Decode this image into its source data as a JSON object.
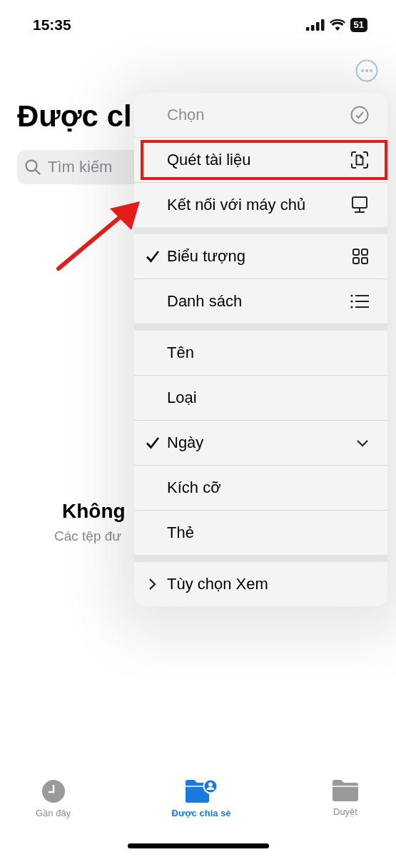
{
  "status_bar": {
    "time": "15:35",
    "battery": "51"
  },
  "title": "Được cl",
  "search": {
    "placeholder": "Tìm kiếm"
  },
  "empty_state": {
    "title": "Không",
    "subtitle": "Các tệp đư"
  },
  "menu": {
    "sections": [
      {
        "items": [
          {
            "label": "Chọn",
            "kind": "select",
            "disabled": true,
            "checked": false,
            "highlighted": false
          },
          {
            "label": "Quét tài liệu",
            "kind": "scan",
            "disabled": false,
            "checked": false,
            "highlighted": true
          },
          {
            "label": "Kết nối với máy chủ",
            "kind": "server",
            "disabled": false,
            "checked": false,
            "highlighted": false
          }
        ]
      },
      {
        "items": [
          {
            "label": "Biểu tượng",
            "kind": "grid",
            "disabled": false,
            "checked": true,
            "highlighted": false
          },
          {
            "label": "Danh sách",
            "kind": "list",
            "disabled": false,
            "checked": false,
            "highlighted": false
          }
        ]
      },
      {
        "items": [
          {
            "label": "Tên",
            "kind": "sort",
            "disabled": false,
            "checked": false,
            "highlighted": false
          },
          {
            "label": "Loại",
            "kind": "sort",
            "disabled": false,
            "checked": false,
            "highlighted": false
          },
          {
            "label": "Ngày",
            "kind": "sort",
            "disabled": false,
            "checked": true,
            "highlighted": false
          },
          {
            "label": "Kích cỡ",
            "kind": "sort",
            "disabled": false,
            "checked": false,
            "highlighted": false
          },
          {
            "label": "Thẻ",
            "kind": "sort",
            "disabled": false,
            "checked": false,
            "highlighted": false
          }
        ]
      },
      {
        "items": [
          {
            "label": "Tùy chọn Xem",
            "kind": "submenu",
            "disabled": false,
            "checked": false,
            "highlighted": false
          }
        ]
      }
    ]
  },
  "tabs": [
    {
      "label": "Gần đây",
      "kind": "recent",
      "selected": false
    },
    {
      "label": "Được chia sẻ",
      "kind": "shared",
      "selected": true
    },
    {
      "label": "Duyệt",
      "kind": "browse",
      "selected": false
    }
  ]
}
